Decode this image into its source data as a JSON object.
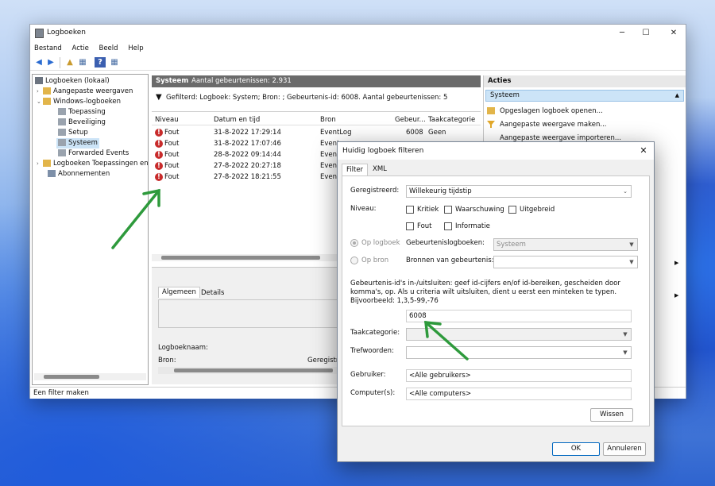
{
  "window": {
    "title": "Logboeken",
    "menu": [
      "Bestand",
      "Actie",
      "Beeld",
      "Help"
    ]
  },
  "tree": {
    "items": [
      {
        "label": "Logboeken (lokaal)"
      },
      {
        "label": "Aangepaste weergaven"
      },
      {
        "label": "Windows-logboeken"
      },
      {
        "label": "Toepassing"
      },
      {
        "label": "Beveiliging"
      },
      {
        "label": "Setup"
      },
      {
        "label": "Systeem"
      },
      {
        "label": "Forwarded Events"
      },
      {
        "label": "Logboeken Toepassingen en"
      },
      {
        "label": "Abonnementen"
      }
    ]
  },
  "center": {
    "log_name": "Systeem",
    "event_count_text": "Aantal gebeurtenissen: 2.931",
    "filter_text": "Gefilterd: Logboek: System; Bron: ; Gebeurtenis-id: 6008. Aantal gebeurtenissen: 5",
    "columns": [
      "Niveau",
      "Datum en tijd",
      "Bron",
      "Gebeur...",
      "Taakcategorie"
    ],
    "rows": [
      {
        "level": "Fout",
        "datetime": "31-8-2022 17:29:14",
        "source": "EventLog",
        "id": "6008",
        "category": "Geen"
      },
      {
        "level": "Fout",
        "datetime": "31-8-2022 17:07:46",
        "source": "Event",
        "id": "",
        "category": ""
      },
      {
        "level": "Fout",
        "datetime": "28-8-2022 09:14:44",
        "source": "Event",
        "id": "",
        "category": ""
      },
      {
        "level": "Fout",
        "datetime": "27-8-2022 20:27:18",
        "source": "Event",
        "id": "",
        "category": ""
      },
      {
        "level": "Fout",
        "datetime": "27-8-2022 18:21:55",
        "source": "Event",
        "id": "",
        "category": ""
      }
    ],
    "detail_tabs": [
      "Algemeen",
      "Details"
    ],
    "detail_logname_label": "Logboeknaam:",
    "detail_source_label": "Bron:",
    "detail_registered_label": "Geregistr"
  },
  "actions": {
    "header": "Acties",
    "section": "Systeem",
    "items": [
      "Opgeslagen logboek openen...",
      "Aangepaste weergave maken...",
      "Aangepaste weergave importeren..."
    ]
  },
  "statusbar": {
    "text": "Een filter maken"
  },
  "dialog": {
    "title": "Huidig logboek filteren",
    "tabs": [
      "Filter",
      "XML"
    ],
    "registered_label": "Geregistreerd:",
    "registered_value": "Willekeurig tijdstip",
    "level_label": "Niveau:",
    "levels": [
      "Kritiek",
      "Waarschuwing",
      "Uitgebreid",
      "Fout",
      "Informatie"
    ],
    "by_log_label": "Op logboek",
    "event_logs_label": "Gebeurtenislogboeken:",
    "event_logs_value": "Systeem",
    "by_source_label": "Op bron",
    "sources_label": "Bronnen van gebeurtenis:",
    "id_help": "Gebeurtenis-id's in-/uitsluiten: geef id-cijfers en/of id-bereiken, gescheiden door komma's, op. Als u criteria wilt uitsluiten, dient u eerst een minteken te typen. Bijvoorbeeld: 1,3,5-99,-76",
    "id_value": "6008",
    "task_category_label": "Taakcategorie:",
    "keywords_label": "Trefwoorden:",
    "user_label": "Gebruiker:",
    "user_value": "<Alle gebruikers>",
    "computer_label": "Computer(s):",
    "computer_value": "<Alle computers>",
    "clear_button": "Wissen",
    "ok_button": "OK",
    "cancel_button": "Annuleren"
  },
  "annotation_color": "#2e9a3c"
}
